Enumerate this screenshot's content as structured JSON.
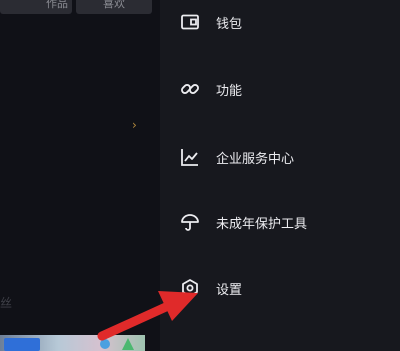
{
  "background": {
    "tabs": [
      {
        "label": "作品"
      },
      {
        "label": "喜欢"
      }
    ],
    "sub_text": "丝"
  },
  "menu": {
    "items": [
      {
        "label": "钱包",
        "icon": "wallet-icon"
      },
      {
        "label": "功能",
        "icon": "link-icon"
      },
      {
        "label": "企业服务中心",
        "icon": "chart-icon"
      },
      {
        "label": "未成年保护工具",
        "icon": "umbrella-icon"
      },
      {
        "label": "设置",
        "icon": "settings-icon"
      }
    ]
  },
  "colors": {
    "drawer_bg": "#17181e",
    "text": "#ececf0",
    "arrow": "#e02a2a"
  }
}
